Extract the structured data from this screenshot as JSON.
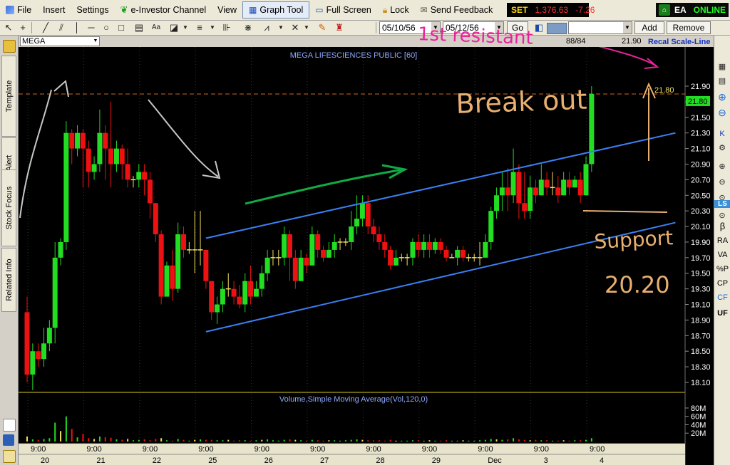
{
  "menu": {
    "items": [
      "File",
      "Insert",
      "Settings",
      "e-Investor Channel",
      "View",
      "Graph Tool",
      "Full Screen",
      "Lock",
      "Send Feedback"
    ],
    "active_index": 5
  },
  "market": {
    "label": "SET",
    "value": "1,376.63",
    "change": "-7.26"
  },
  "status": {
    "badge": "EA",
    "state": "ONLINE"
  },
  "toolbar": {
    "date_from": "05/10/56",
    "date_to": "05/12/56",
    "go_label": "Go",
    "add_label": "Add",
    "remove_label": "Remove"
  },
  "left_tabs": [
    "Template",
    "Alert",
    "Stock Focus",
    "Related Info"
  ],
  "right_tools": [
    "LS",
    "β",
    "RA",
    "VA",
    "%P",
    "CP",
    "CF",
    "UF"
  ],
  "symbol_bar": {
    "symbol": "MEGA",
    "bar_count": "88/84",
    "last_price": "21.90",
    "recal_label": "Recal Scale-Line"
  },
  "colors": {
    "up": "#22dd22",
    "down": "#ee1111",
    "doji": "#f0e060",
    "channel": "#3a7ff2",
    "resistance": "#d2691e",
    "annotation_pink": "#e8249a",
    "annotation_orange": "#e8b070",
    "annotation_green": "#11aa44",
    "annotation_gray": "#c8c8c8",
    "axis_text": "#ffffff",
    "title_text": "#8fa8ff"
  },
  "chart_data": {
    "type": "candlestick",
    "title": "MEGA LIFESCIENCES PUBLIC [60]",
    "volume_title": "Volume,Simple Moving Average(Vol,120,0)",
    "y_ticks": [
      "21.90",
      "21.70",
      "21.50",
      "21.30",
      "21.10",
      "20.90",
      "20.70",
      "20.50",
      "20.30",
      "20.10",
      "19.90",
      "19.70",
      "19.50",
      "19.30",
      "19.10",
      "18.90",
      "18.70",
      "18.50",
      "18.30",
      "18.10"
    ],
    "ylim": [
      18.0,
      22.0
    ],
    "volume_ticks": [
      "80M",
      "60M",
      "40M",
      "20M"
    ],
    "x_ticks": [
      {
        "bar": 0,
        "time": "9:00",
        "day": "20"
      },
      {
        "bar": 10,
        "time": "9:00",
        "day": "21"
      },
      {
        "bar": 20,
        "time": "9:00",
        "day": "22"
      },
      {
        "bar": 30,
        "time": "9:00",
        "day": "25"
      },
      {
        "bar": 40,
        "time": "9:00",
        "day": "26"
      },
      {
        "bar": 50,
        "time": "9:00",
        "day": "27"
      },
      {
        "bar": 60,
        "time": "9:00",
        "day": "28"
      },
      {
        "bar": 70,
        "time": "9:00",
        "day": "29"
      },
      {
        "bar": 80,
        "time": "9:00",
        "day": "Dec"
      },
      {
        "bar": 90,
        "time": "9:00",
        "day": "3"
      },
      {
        "bar": 100,
        "time": "9:00",
        "day": "4"
      }
    ],
    "candles": [
      [
        19.0,
        18.2,
        19.2,
        18.1
      ],
      [
        18.2,
        18.5,
        18.6,
        18.0
      ],
      [
        18.5,
        18.4,
        18.6,
        18.3
      ],
      [
        18.4,
        18.6,
        18.8,
        18.3
      ],
      [
        18.6,
        18.8,
        18.9,
        18.5
      ],
      [
        18.8,
        19.7,
        19.9,
        18.6
      ],
      [
        19.7,
        19.9,
        19.95,
        19.6
      ],
      [
        19.9,
        21.3,
        21.45,
        19.8
      ],
      [
        21.3,
        21.1,
        21.35,
        20.9
      ],
      [
        21.1,
        21.3,
        21.4,
        21.0
      ],
      [
        21.3,
        21.1,
        21.35,
        20.6
      ],
      [
        21.1,
        20.8,
        21.2,
        20.6
      ],
      [
        20.8,
        20.9,
        21.0,
        20.7
      ],
      [
        20.9,
        21.3,
        21.6,
        20.8
      ],
      [
        21.3,
        21.1,
        21.4,
        20.7
      ],
      [
        21.1,
        20.9,
        21.7,
        20.6
      ],
      [
        20.9,
        21.1,
        21.2,
        20.8
      ],
      [
        21.1,
        20.9,
        21.15,
        20.7
      ],
      [
        20.9,
        20.7,
        21.1,
        20.6
      ],
      [
        20.7,
        20.7,
        20.75,
        20.6
      ],
      [
        20.7,
        20.8,
        20.9,
        20.6
      ],
      [
        20.8,
        20.7,
        20.9,
        20.5
      ],
      [
        20.7,
        20.4,
        20.8,
        20.2
      ],
      [
        20.4,
        20.0,
        20.4,
        19.9
      ],
      [
        20.0,
        19.2,
        20.05,
        19.1
      ],
      [
        19.2,
        19.6,
        19.65,
        19.5
      ],
      [
        19.6,
        19.3,
        19.8,
        19.15
      ],
      [
        19.3,
        20.0,
        20.15,
        19.25
      ],
      [
        20.0,
        19.8,
        20.1,
        19.7
      ],
      [
        19.8,
        19.8,
        19.9,
        19.75
      ],
      [
        19.8,
        19.8,
        20.3,
        19.5
      ],
      [
        19.8,
        19.8,
        20.3,
        19.6
      ],
      [
        19.8,
        19.4,
        19.8,
        19.3
      ],
      [
        19.4,
        19.0,
        19.4,
        18.9
      ],
      [
        19.0,
        19.1,
        19.2,
        18.85
      ],
      [
        19.1,
        19.3,
        19.4,
        19.0
      ],
      [
        19.3,
        19.3,
        19.5,
        19.2
      ],
      [
        19.3,
        19.2,
        19.4,
        19.1
      ],
      [
        19.2,
        19.1,
        19.35,
        19.05
      ],
      [
        19.1,
        19.4,
        19.5,
        19.0
      ],
      [
        19.4,
        19.2,
        19.6,
        19.1
      ],
      [
        19.2,
        19.3,
        19.4,
        19.2
      ],
      [
        19.3,
        19.5,
        19.6,
        19.2
      ],
      [
        19.5,
        19.7,
        19.8,
        19.4
      ],
      [
        19.7,
        19.7,
        19.8,
        19.6
      ],
      [
        19.7,
        19.7,
        19.8,
        19.6
      ],
      [
        19.7,
        20.0,
        20.1,
        19.6
      ],
      [
        20.0,
        19.7,
        20.05,
        19.4
      ],
      [
        19.7,
        19.4,
        19.8,
        19.3
      ],
      [
        19.4,
        19.7,
        19.8,
        19.4
      ],
      [
        19.7,
        19.6,
        19.75,
        19.5
      ],
      [
        19.6,
        20.0,
        20.1,
        19.6
      ],
      [
        20.0,
        19.8,
        20.05,
        19.7
      ],
      [
        19.8,
        19.7,
        19.85,
        19.65
      ],
      [
        19.7,
        19.8,
        19.9,
        19.7
      ],
      [
        19.8,
        19.9,
        20.0,
        19.7
      ],
      [
        19.9,
        19.9,
        19.95,
        19.8
      ],
      [
        19.9,
        19.9,
        19.95,
        19.85
      ],
      [
        19.9,
        20.1,
        20.3,
        19.8
      ],
      [
        20.1,
        20.2,
        20.5,
        20.0
      ],
      [
        20.2,
        20.4,
        20.5,
        20.1
      ],
      [
        20.4,
        20.1,
        20.5,
        20.0
      ],
      [
        20.1,
        20.0,
        20.2,
        19.9
      ],
      [
        20.0,
        19.9,
        20.1,
        19.8
      ],
      [
        19.9,
        19.8,
        20.0,
        19.7
      ],
      [
        19.8,
        19.6,
        19.85,
        19.55
      ],
      [
        19.6,
        19.7,
        19.8,
        19.6
      ],
      [
        19.7,
        19.7,
        19.75,
        19.65
      ],
      [
        19.7,
        19.7,
        19.75,
        19.6
      ],
      [
        19.7,
        19.9,
        19.95,
        19.6
      ],
      [
        19.9,
        19.8,
        20.0,
        19.7
      ],
      [
        19.8,
        19.9,
        20.0,
        19.7
      ],
      [
        19.9,
        19.8,
        20.0,
        19.7
      ],
      [
        19.8,
        19.9,
        19.95,
        19.75
      ],
      [
        19.9,
        19.8,
        19.95,
        19.75
      ],
      [
        19.8,
        19.7,
        19.85,
        19.65
      ],
      [
        19.7,
        19.7,
        19.75,
        19.7
      ],
      [
        19.7,
        19.8,
        19.85,
        19.6
      ],
      [
        19.8,
        19.7,
        19.85,
        19.65
      ],
      [
        19.7,
        19.7,
        19.75,
        19.65
      ],
      [
        19.7,
        19.7,
        19.75,
        19.65
      ],
      [
        19.7,
        19.7,
        19.9,
        19.6
      ],
      [
        19.7,
        19.9,
        20.0,
        19.7
      ],
      [
        19.9,
        20.3,
        20.35,
        19.8
      ],
      [
        20.3,
        20.5,
        20.6,
        20.2
      ],
      [
        20.5,
        20.6,
        20.8,
        20.3
      ],
      [
        20.6,
        20.5,
        20.85,
        20.3
      ],
      [
        20.5,
        20.8,
        21.1,
        20.4
      ],
      [
        20.8,
        20.4,
        20.9,
        20.2
      ],
      [
        20.4,
        20.3,
        20.8,
        20.2
      ],
      [
        20.3,
        20.6,
        20.75,
        20.2
      ],
      [
        20.6,
        20.5,
        20.7,
        20.4
      ],
      [
        20.5,
        20.7,
        20.9,
        20.5
      ],
      [
        20.7,
        20.6,
        20.8,
        20.5
      ],
      [
        20.6,
        20.6,
        20.8,
        20.5
      ],
      [
        20.6,
        20.5,
        20.75,
        20.4
      ],
      [
        20.5,
        20.7,
        20.8,
        20.5
      ],
      [
        20.7,
        20.6,
        20.8,
        20.5
      ],
      [
        20.6,
        20.7,
        20.75,
        20.6
      ],
      [
        20.7,
        20.5,
        20.8,
        20.4
      ],
      [
        20.5,
        20.9,
        21.0,
        20.5
      ],
      [
        20.9,
        21.8,
        21.9,
        20.8
      ]
    ],
    "volumes": [
      12,
      5,
      4,
      6,
      8,
      45,
      25,
      60,
      30,
      10,
      18,
      8,
      6,
      12,
      10,
      9,
      5,
      4,
      6,
      3,
      4,
      5,
      3,
      6,
      8,
      3,
      2,
      6,
      4,
      2,
      4,
      5,
      4,
      4,
      3,
      3,
      4,
      2,
      3,
      3,
      2,
      3,
      4,
      5,
      3,
      2,
      4,
      5,
      4,
      3,
      2,
      4,
      3,
      2,
      3,
      3,
      2,
      3,
      4,
      5,
      4,
      3,
      3,
      3,
      2,
      4,
      2,
      2,
      2,
      3,
      3,
      2,
      3,
      2,
      2,
      3,
      2,
      2,
      3,
      2,
      2,
      3,
      4,
      6,
      5,
      4,
      5,
      8,
      5,
      4,
      3,
      4,
      3,
      3,
      2,
      2,
      3,
      2,
      3,
      3,
      4,
      8
    ],
    "trendlines": [
      {
        "name": "channel-upper",
        "from": [
          32,
          19.95
        ],
        "to": [
          116,
          21.3
        ]
      },
      {
        "name": "channel-lower",
        "from": [
          32,
          18.75
        ],
        "to": [
          116,
          20.15
        ]
      }
    ],
    "resistance_level": 21.8,
    "resistance_label": "21.80",
    "last_label": "21.80",
    "annotations": {
      "resistance": "1st resistant",
      "breakout": "Break out",
      "support_title": "Support",
      "support_value": "20.20"
    }
  }
}
